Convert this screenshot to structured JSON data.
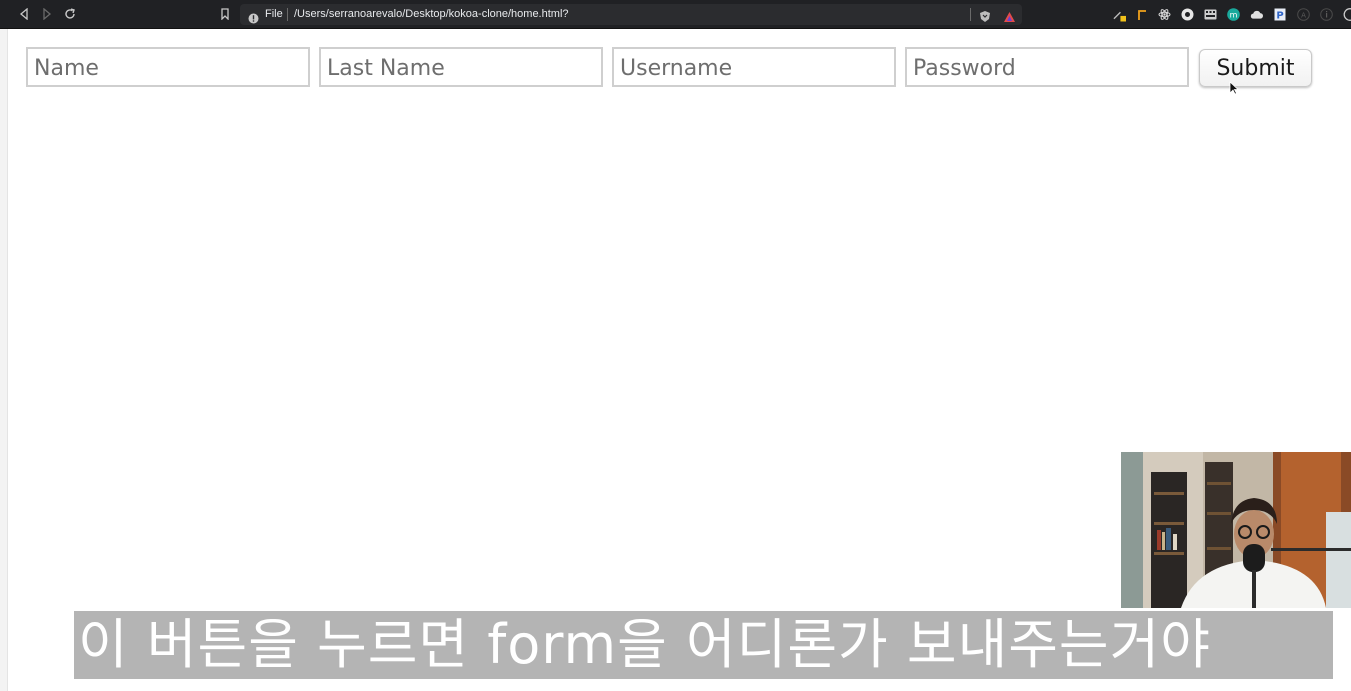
{
  "browser": {
    "scheme_label": "File",
    "url": "/Users/serranoarevalo/Desktop/kokoa-clone/home.html?",
    "icons": [
      "back-icon",
      "forward-icon",
      "reload-icon",
      "bookmark-icon",
      "info-icon",
      "brave-shield-icon",
      "brave-rewards-icon"
    ]
  },
  "extensions": [
    "pencil-extension-icon",
    "flag-extension-icon",
    "react-devtools-icon",
    "record-extension-icon",
    "keyboard-extension-icon",
    "m-extension-icon",
    "cloud-extension-icon",
    "p-extension-icon",
    "a-extension-icon",
    "info-extension-icon",
    "circle-extension-icon"
  ],
  "form": {
    "name_placeholder": "Name",
    "last_name_placeholder": "Last Name",
    "username_placeholder": "Username",
    "password_placeholder": "Password",
    "submit_label": "Submit"
  },
  "subtitle": "이 버튼을 누르면 form을 어디론가 보내주는거야",
  "colors": {
    "toolbar": "#202124",
    "field_border": "#cfcfcf",
    "caption_bg": "#b4b4b4"
  }
}
